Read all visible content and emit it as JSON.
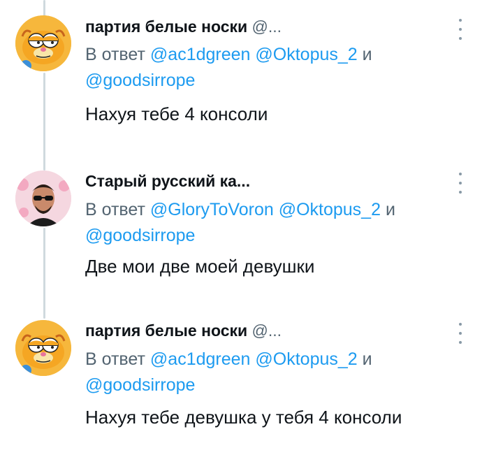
{
  "tweets": [
    {
      "author_name": "партия белые носки",
      "author_handle": "@...",
      "avatar_icon": "garfield-avatar",
      "reply_prefix": "В ответ",
      "mentions": [
        "@ac1dgreen",
        "@Oktopus_2",
        "@goodsirrope"
      ],
      "conjunction": "и",
      "text": "Нахуя тебе 4 консоли"
    },
    {
      "author_name": "Старый русский ка...",
      "author_handle": "",
      "avatar_icon": "man-sunglasses-avatar",
      "reply_prefix": "В ответ",
      "mentions": [
        "@GloryToVoron",
        "@Oktopus_2",
        "@goodsirrope"
      ],
      "conjunction": "и",
      "text": "Две мои две моей девушки"
    },
    {
      "author_name": "партия белые носки",
      "author_handle": "@...",
      "avatar_icon": "garfield-avatar",
      "reply_prefix": "В ответ",
      "mentions": [
        "@ac1dgreen",
        "@Oktopus_2",
        "@goodsirrope"
      ],
      "conjunction": "и",
      "text": "Нахуя тебе девушка у тебя 4 консоли"
    }
  ],
  "colors": {
    "mention": "#1d9bf0",
    "secondary_text": "#536471",
    "thread_line": "#cfd9de"
  }
}
